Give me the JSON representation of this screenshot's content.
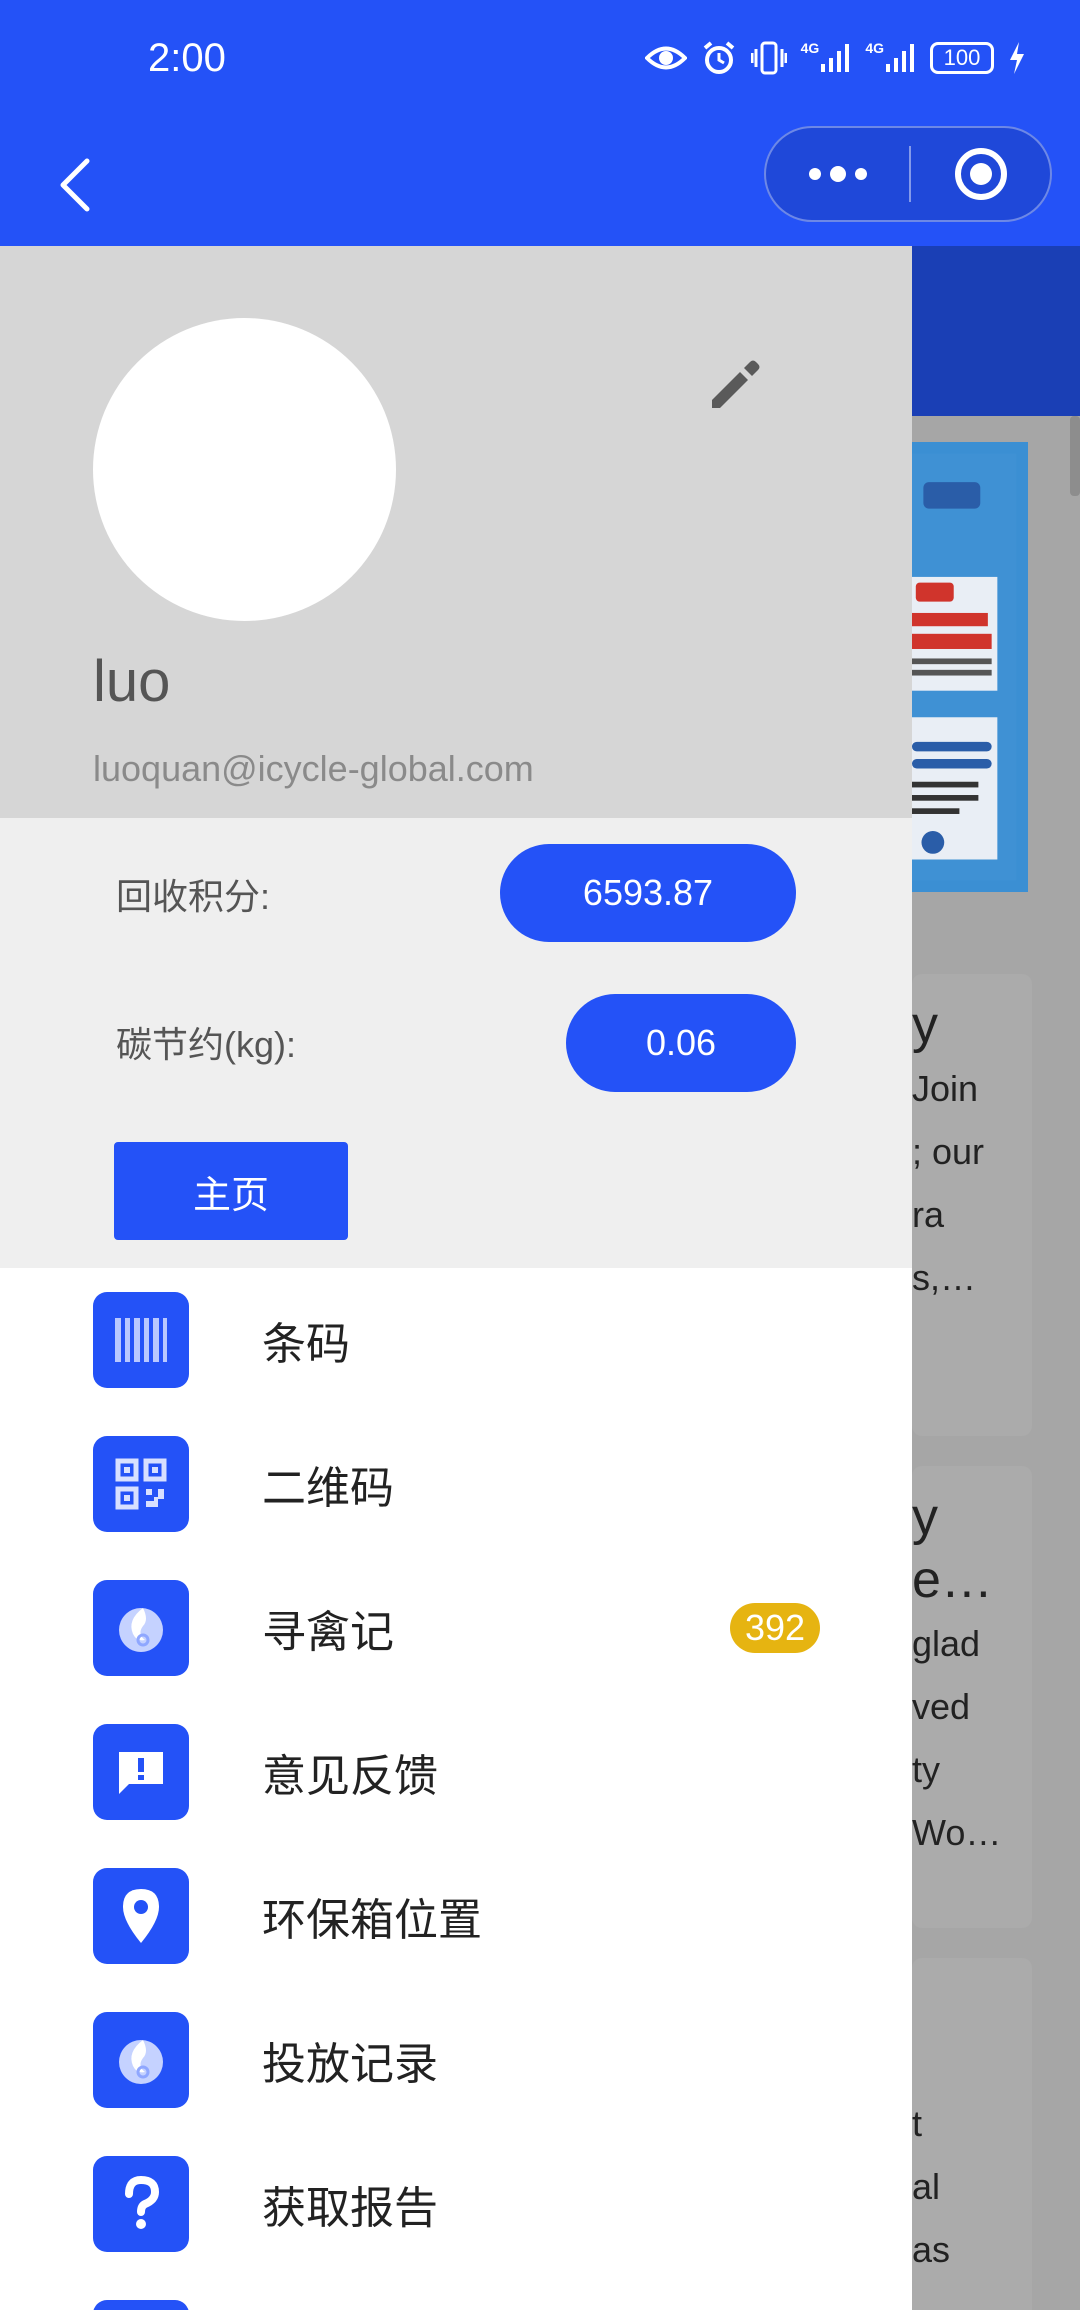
{
  "status_bar": {
    "time": "2:00",
    "battery": "100",
    "network_1": "4G",
    "network_2": "4G"
  },
  "nav": {
    "back_icon": "chevron-left-icon",
    "more_icon": "more-dots-icon",
    "close_icon": "target-close-icon"
  },
  "profile": {
    "name": "luo",
    "email": "luoquan@icycle-global.com",
    "edit_icon": "pencil-icon"
  },
  "stats": {
    "points_label": "回收积分:",
    "points_value": "6593.87",
    "carbon_label": "碳节约(kg):",
    "carbon_value": "0.06",
    "home_button": "主页"
  },
  "menu": [
    {
      "label": "条码",
      "icon": "barcode-icon"
    },
    {
      "label": "二维码",
      "icon": "qr-code-icon"
    },
    {
      "label": "寻禽记",
      "icon": "flame-icon",
      "badge": "392"
    },
    {
      "label": "意见反馈",
      "icon": "feedback-icon"
    },
    {
      "label": "环保箱位置",
      "icon": "location-pin-icon"
    },
    {
      "label": "投放记录",
      "icon": "flame-icon"
    },
    {
      "label": "获取报告",
      "icon": "question-icon"
    }
  ],
  "background_page": {
    "card1_lines": [
      "y",
      "",
      "Join",
      "; our",
      "ra",
      "s,…"
    ],
    "card2_lines": [
      "y",
      "e…",
      " glad",
      "ved",
      "ty",
      "Wo…"
    ],
    "card3_lines": [
      "t",
      "al",
      "as"
    ]
  },
  "colors": {
    "brand_blue": "#2452f7",
    "badge_yellow": "#e6b411",
    "profile_bg": "#d6d6d6",
    "stats_bg": "#efefef"
  }
}
